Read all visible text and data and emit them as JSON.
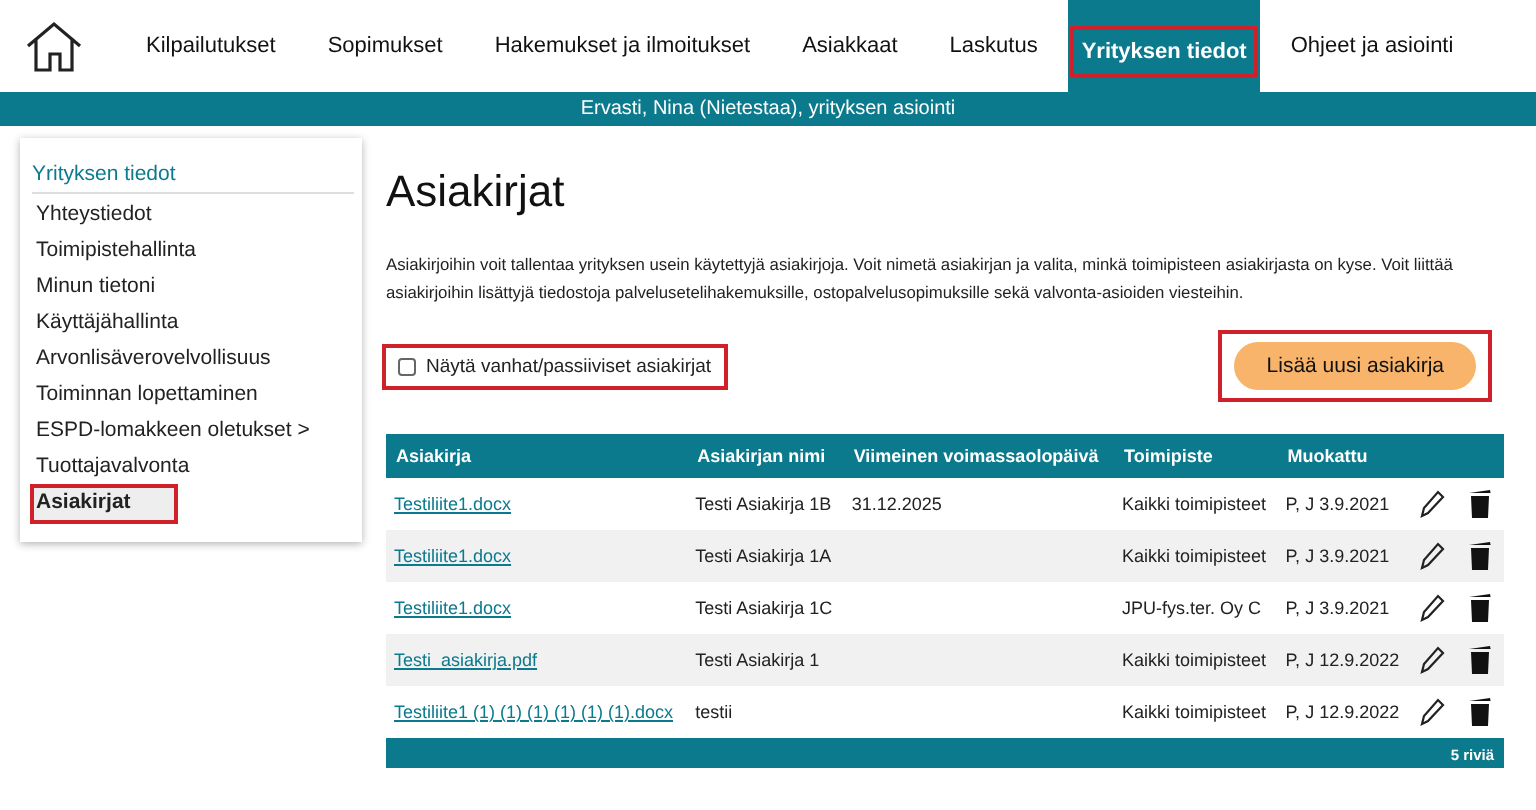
{
  "nav": {
    "tabs": [
      {
        "label": "Kilpailutukset",
        "selected": false,
        "highlighted": false
      },
      {
        "label": "Sopimukset",
        "selected": false,
        "highlighted": false
      },
      {
        "label": "Hakemukset ja ilmoitukset",
        "selected": false,
        "highlighted": false
      },
      {
        "label": "Asiakkaat",
        "selected": false,
        "highlighted": false
      },
      {
        "label": "Laskutus",
        "selected": false,
        "highlighted": false
      },
      {
        "label": "Yrityksen tiedot",
        "selected": true,
        "highlighted": true
      },
      {
        "label": "Ohjeet ja asiointi",
        "selected": false,
        "highlighted": false
      }
    ]
  },
  "user_bar": {
    "text": "Ervasti, Nina (Nietestaa), yrityksen asiointi"
  },
  "sidebar": {
    "heading": "Yrityksen tiedot",
    "items": [
      {
        "label": "Yhteystiedot",
        "selected": false,
        "highlighted": false
      },
      {
        "label": "Toimipistehallinta",
        "selected": false,
        "highlighted": false
      },
      {
        "label": "Minun tietoni",
        "selected": false,
        "highlighted": false
      },
      {
        "label": "Käyttäjähallinta",
        "selected": false,
        "highlighted": false
      },
      {
        "label": "Arvonlisäverovelvollisuus",
        "selected": false,
        "highlighted": false
      },
      {
        "label": "Toiminnan lopettaminen",
        "selected": false,
        "highlighted": false
      },
      {
        "label": "ESPD-lomakkeen oletukset >",
        "selected": false,
        "highlighted": false
      },
      {
        "label": "Tuottajavalvonta",
        "selected": false,
        "highlighted": false
      },
      {
        "label": "Asiakirjat",
        "selected": true,
        "highlighted": true
      }
    ]
  },
  "main": {
    "title": "Asiakirjat",
    "description": "Asiakirjoihin voit tallentaa yrityksen usein käytettyjä asiakirjoja. Voit nimetä asiakirjan ja valita, minkä toimipisteen asiakirjasta on kyse. Voit liittää asiakirjoihin lisättyjä tiedostoja palvelusetelihakemuksille, ostopalvelusopimuksille sekä valvonta-asioiden viesteihin.",
    "show_old_checkbox": {
      "label": "Näytä vanhat/passiiviset asiakirjat",
      "checked": false,
      "highlighted": true
    },
    "add_button": {
      "label": "Lisää uusi asiakirja",
      "highlighted": true
    }
  },
  "table": {
    "columns": [
      "Asiakirja",
      "Asiakirjan nimi",
      "Viimeinen voimassaolopäivä",
      "Toimipiste",
      "Muokattu"
    ],
    "rows": [
      {
        "file": "Testiliite1.docx",
        "name": "Testi Asiakirja 1B",
        "valid_until": "31.12.2025",
        "location": "Kaikki toimipisteet",
        "modified": "P, J 3.9.2021"
      },
      {
        "file": "Testiliite1.docx",
        "name": "Testi Asiakirja 1A",
        "valid_until": "",
        "location": "Kaikki toimipisteet",
        "modified": "P, J 3.9.2021"
      },
      {
        "file": "Testiliite1.docx",
        "name": "Testi Asiakirja 1C",
        "valid_until": "",
        "location": "JPU-fys.ter. Oy C",
        "modified": "P, J 3.9.2021"
      },
      {
        "file": "Testi_asiakirja.pdf",
        "name": "Testi Asiakirja 1",
        "valid_until": "",
        "location": "Kaikki toimipisteet",
        "modified": "P, J 12.9.2022"
      },
      {
        "file": "Testiliite1 (1) (1) (1) (1) (1) (1).docx",
        "name": "testii",
        "valid_until": "",
        "location": "Kaikki toimipisteet",
        "modified": "P, J 12.9.2022"
      }
    ],
    "footer": "5 riviä"
  }
}
